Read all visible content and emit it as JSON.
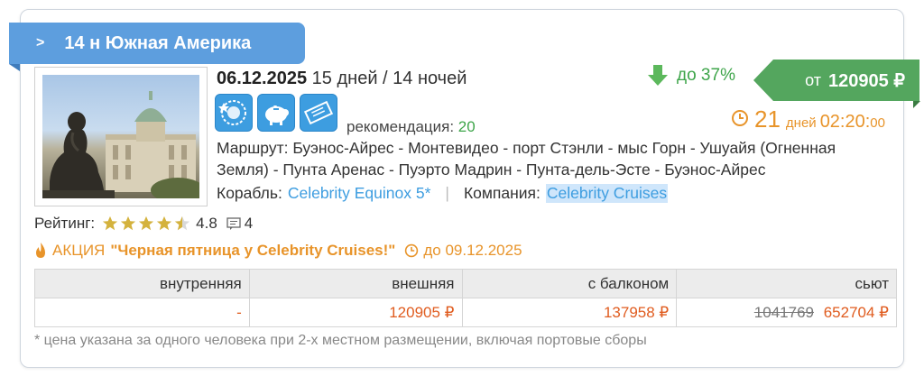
{
  "header": {
    "title": "14 н Южная Америка"
  },
  "trip": {
    "date": "06.12.2025",
    "duration": "15 дней / 14 ночей",
    "recommend_label": "рекомендация:",
    "recommend_value": "20",
    "route_label": "Маршрут:",
    "route": "Буэнос-Айрес - Монтевидео - порт Стэнли - мыс Горн - Ушуайя (Огненная Земля) - Пунта Аренас - Пуэрто Мадрин - Пунта-дель-Эсте - Буэнос-Айрес",
    "ship_label": "Корабль:",
    "ship": "Celebrity Equinox 5*",
    "separator": "|",
    "company_label": "Компания:",
    "company": "Celebrity Cruises"
  },
  "feature_icons": [
    "premium-icon",
    "piggy-bank-icon",
    "ticket-icon"
  ],
  "offer": {
    "discount": "до 37%",
    "price_prefix": "от",
    "price": "120905 ₽",
    "timer_days": "21",
    "timer_days_label": "дней",
    "timer_time": "02:20:",
    "timer_seconds": "00"
  },
  "rating": {
    "label": "Рейтинг:",
    "score": "4.8",
    "stars": 4.5,
    "comments": "4"
  },
  "promo": {
    "prefix": "АКЦИЯ",
    "name": "\"Черная пятница у Celebrity Cruises!\"",
    "until": "до 09.12.2025"
  },
  "cabins": {
    "headers": [
      "внутренняя",
      "внешняя",
      "с балконом",
      "сьют"
    ],
    "inner": "-",
    "outer": "120905 ₽",
    "balcony": "137958 ₽",
    "suite_old": "1041769",
    "suite": "652704 ₽"
  },
  "footnote": "* цена указана за одного человека при 2-х местном размещении, включая портовые сборы",
  "colors": {
    "accent": "#5d9ede",
    "green": "#54a65e",
    "orange": "#e8942a",
    "price": "#e05c1f",
    "link": "#3d9de0"
  }
}
